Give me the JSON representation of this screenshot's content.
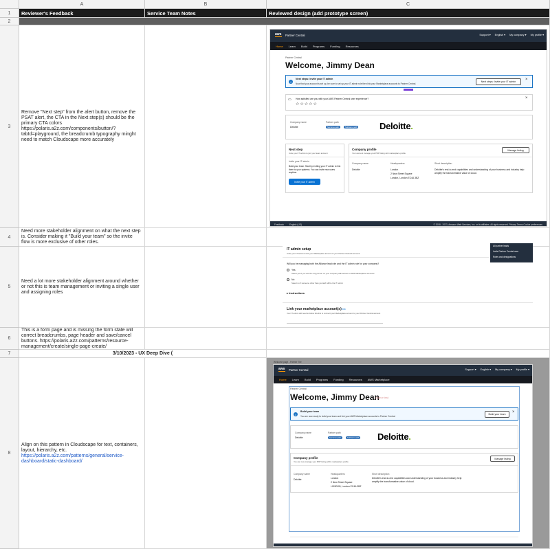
{
  "columns": [
    "A",
    "B",
    "C"
  ],
  "row_numbers": [
    "1",
    "2",
    "3",
    "4",
    "5",
    "6",
    "7",
    "8"
  ],
  "headers": {
    "a": "Reviewer's Feedback",
    "b": "Service Team Notes",
    "c": "Reviewed design (add prototype screen)"
  },
  "rows": {
    "r3": "Remove \"Next step\" from the alert button, remove the PSAT alert, the CTA in the Next step(s) should be the primary CTA colors https://polaris.a2z.com/components/button/?tabId=playground, the breadcrumb typography minght need to match Cloudscape more accurately",
    "r4": "Need more stakeholder alignment on what the next step is. Consider making it \"Build your team\" so the invite flow is more exclusive of other roles.",
    "r5": "Need a lot more stakeholder alignment around whether or not this is team management or inviting a single user and assigning roles",
    "r6": "This is a form page and is missing the form state will correct breadcrumbs, page header and save/cancel buttons. https://polaris.a2z.com/patterns/resource-management/create/single-page-create/",
    "r7": "3/10/2023 - UX Deep Dive (",
    "r8_text": "Align on this pattern in Cloudscape for text, containers, layout, hierarchy, etc.",
    "r8_link": "https://polaris.a2z.com/patterns/general/service-dashboard/static-dashboard/"
  },
  "mock1": {
    "logo": "aws",
    "brand": "Partner Central",
    "top_right": [
      "Support ▾",
      "English ▾",
      "My company ▾",
      "My profile ▾"
    ],
    "nav": [
      "Home",
      "Learn",
      "Build",
      "Programs",
      "Funding",
      "Resources"
    ],
    "breadcrumb": "Partner Central",
    "welcome": "Welcome, Jimmy Dean",
    "alert_title": "Next steps: Invite your IT admin",
    "alert_body": "Now that your account is set up, be sure to set up your IT admin role then link your Marketplace accounts to Partner Central.",
    "alert_button": "Next steps: Invite your IT admin",
    "psat_title": "How satisfied are you with your AWS Partner Central user experience?",
    "stars": "☆☆☆☆☆",
    "company_name_label": "Company name",
    "company_name": "Deloitte",
    "partner_path_label": "Partner path",
    "pills": [
      "Services path",
      "Software path"
    ],
    "deloitte": "Deloitte",
    "next_step_title": "Next step",
    "next_step_sub": "Invite your IT admin to join your team account",
    "invite_heading": "Invite your IT admin",
    "invite_body": "Build your team. Start by inviting your IT admin to link them to your systems. You can invite new users anytime.",
    "invite_button": "Invite your IT admin",
    "profile_title": "Company profile",
    "profile_sub": "Your account manage your PDP listing with marketplace profile",
    "manage_button": "Manage listing",
    "company_name_col": "Company name",
    "headquarters_col": "Headquarters",
    "short_desc_col": "Short description",
    "hq_lines": [
      "London",
      "2 New Street Square",
      "London, London EC4A 3BZ"
    ],
    "desc": "Deloitte's end-to-end capabilities and understanding of your business and industry help amplify the transformative value of cloud.",
    "footer_left": "Feedback",
    "footer_lang": "English (US)",
    "footer_right": "© 2008 - 2023, Amazon Web Services, Inc. or its affiliates. All rights reserved.   Privacy   Terms   Cookie preferences"
  },
  "mock2": {
    "title": "IT admin setup",
    "sub": "Invite your IT admin to link your Marketplace account to your Partner Network account",
    "question": "Will you be managing both the Alliance lead role and the IT admin role for your company?",
    "yes": "Yes",
    "yes_hint": "Select yes if you are the only person on your company with access to AWS Marketplace accounts",
    "no": "No",
    "no_hint": "Select no if someone other than yourself will be the IT admin",
    "instructions": "▸ Instructions",
    "link_title": "Link your marketplace account(s)",
    "link_badge": "Info",
    "link_sub": "Your IT admin will need to follow this link to connect your Marketplace account to your Partner Central account",
    "menu": [
      "All partner leads",
      "Invite Partner Central user",
      "Roles and designations"
    ]
  },
  "mock3": {
    "caption": "Welcome page - Partner Tier",
    "logo": "aws",
    "brand": "Partner Central",
    "top_right": [
      "Support ▾",
      "English ▾",
      "My company ▾",
      "My profile ▾"
    ],
    "nav": [
      "Home",
      "Learn",
      "Build",
      "Programs",
      "Funding",
      "Resources",
      "AWS Marketplace"
    ],
    "breadcrumb": "Partner Central",
    "welcome": "Welcome, Jimmy Dean",
    "welcome_tag": "Alliance lead",
    "alert_title": "Build your team",
    "alert_body": "You are now ready to build your team and link your AWS Marketplace accounts to Partner Central.",
    "alert_button": "Build your team",
    "company_name_label": "Company name",
    "company_name": "Deloitte",
    "partner_path_label": "Partner path",
    "pills": [
      "Services path",
      "Software path"
    ],
    "deloitte": "Deloitte",
    "profile_title": "Company profile",
    "profile_sub": "You can now manage your PDP listing within marketplace profile",
    "manage_button": "Manage listing",
    "company_name_col": "Company name",
    "headquarters_col": "Headquarters",
    "short_desc_col": "Short description",
    "hq_lines": [
      "London",
      "2 New Street Square",
      "LONDON, London EC4A 3BZ"
    ],
    "desc": "Deloitte's end-to-end capabilities and understanding of your business and industry help amplify the transformative value of cloud."
  },
  "colors": {
    "header_bg": "#1b1b1b",
    "aws_nav": "#232f3e",
    "aws_orange": "#ff9900",
    "primary_blue": "#0972d3",
    "deloitte_green": "#86bc25"
  }
}
